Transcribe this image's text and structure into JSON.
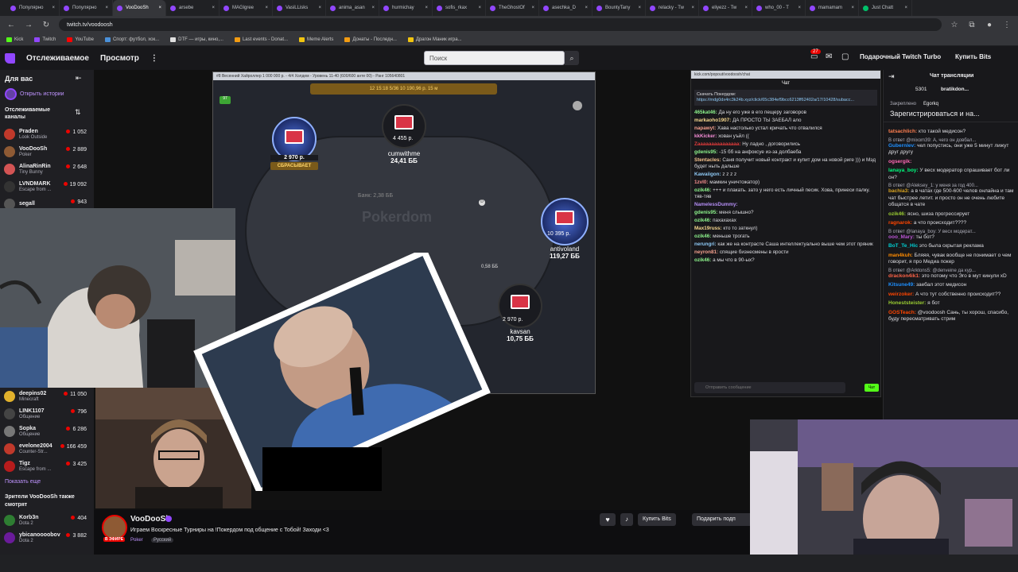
{
  "browser": {
    "tabs": [
      {
        "label": "Популярно",
        "color": "#9147ff"
      },
      {
        "label": "Популярно",
        "color": "#9147ff"
      },
      {
        "label": "VooDooSh",
        "color": "#9147ff",
        "active": true
      },
      {
        "label": "arsebe",
        "color": "#9147ff"
      },
      {
        "label": "MAGlgree",
        "color": "#9147ff"
      },
      {
        "label": "VasiLLisks",
        "color": "#9147ff"
      },
      {
        "label": "anima_asan",
        "color": "#9147ff"
      },
      {
        "label": "hurmichay",
        "color": "#9147ff"
      },
      {
        "label": "sofis_rkax",
        "color": "#9147ff"
      },
      {
        "label": "TheGhostOf",
        "color": "#9147ff"
      },
      {
        "label": "asechka_D",
        "color": "#9147ff"
      },
      {
        "label": "BountyTany",
        "color": "#9147ff"
      },
      {
        "label": "relacky - Tw",
        "color": "#9147ff"
      },
      {
        "label": "eliyezz - Tw",
        "color": "#9147ff"
      },
      {
        "label": "who_00 - T",
        "color": "#9147ff"
      },
      {
        "label": "mamamam",
        "color": "#9147ff"
      },
      {
        "label": "Just Chatt",
        "color": "#00c16a"
      }
    ],
    "url": "twitch.tv/voodoosh",
    "bookmarks": [
      {
        "label": "Kick",
        "color": "#53fc18"
      },
      {
        "label": "Twitch",
        "color": "#9147ff"
      },
      {
        "label": "YouTube",
        "color": "#ff0000"
      },
      {
        "label": "Спорт: футбол, хок...",
        "color": "#4a90d9"
      },
      {
        "label": "DTF — игры, кино,...",
        "color": "#e0e0e0"
      },
      {
        "label": "Last events - Donat...",
        "color": "#f39c12"
      },
      {
        "label": "Meme Alerts",
        "color": "#f1c40f"
      },
      {
        "label": "Донаты - Последн...",
        "color": "#f39c12"
      },
      {
        "label": "Драгон Маник игра...",
        "color": "#f1c40f"
      }
    ]
  },
  "topnav": {
    "following": "Отслеживаемое",
    "browse": "Просмотр",
    "more": "⋮",
    "search_placeholder": "Поиск",
    "notif_count": "27",
    "turbo": "Подарочный Twitch Turbo",
    "buy_bits": "Купить Bits"
  },
  "sidebar": {
    "title": "Для вас",
    "stories": "Открыть истории",
    "followed_title": "Отслеживаемые каналы",
    "channels": [
      {
        "name": "Praden",
        "game": "Look Outside",
        "viewers": "1 052",
        "color": "#c0392b"
      },
      {
        "name": "VooDooSh",
        "game": "Poker",
        "viewers": "2 889",
        "color": "#8e5a34"
      },
      {
        "name": "AlinaRinRin",
        "game": "Tiny Bunny",
        "viewers": "2 648",
        "color": "#d35454"
      },
      {
        "name": "LVNDMARK",
        "game": "Escape from ...",
        "viewers": "19 092",
        "color": "#333"
      },
      {
        "name": "segall",
        "game": "",
        "viewers": "943",
        "color": "#555"
      }
    ],
    "channels2": [
      {
        "name": "deepins02",
        "game": "Minecraft",
        "viewers": "11 050",
        "color": "#e1b12c"
      },
      {
        "name": "LINK1107",
        "game": "Общение",
        "viewers": "796",
        "color": "#444"
      },
      {
        "name": "Sopka",
        "game": "Общение",
        "viewers": "6 286",
        "color": "#777"
      },
      {
        "name": "evelone2004",
        "game": "Counter-Str...",
        "viewers": "166 459",
        "color": "#c0392b"
      },
      {
        "name": "Tigz",
        "game": "Escape from ...",
        "viewers": "3 425",
        "color": "#b71c1c"
      }
    ],
    "show_more": "Показать еще",
    "also_watch": "Зрители VooDooSh также смотрят",
    "channels3": [
      {
        "name": "Korb3n",
        "game": "Dota 2",
        "viewers": "404",
        "color": "#2e7d32"
      },
      {
        "name": "ybicanoooobov",
        "game": "Dota 2",
        "viewers": "3 882",
        "color": "#6a1b9a"
      }
    ]
  },
  "poker": {
    "title": "#8 Весенний Хайроллер 1 000 000 р. - 4/4 Холдем - Уровень 11-40 (600/600 анте 00) - Ранг 105640801",
    "top_bar": "12 15:18  5/36  10 190,96 р.  15 м",
    "pot": "Банк: 2,38 ББ",
    "brand": "Pokerdom",
    "seats": [
      {
        "nick": "",
        "stack": "2 970 р.",
        "action": "СБРАСЫВАЕТ"
      },
      {
        "nick": "cumwithme",
        "stack": "24,41 ББ",
        "bet": "4 455 р."
      },
      {
        "nick": "antivoland",
        "stack": "119,27 ББ",
        "bet": "10 395 р."
      },
      {
        "nick": "kavsan",
        "stack": "10,75 ББ",
        "bet": "2 970 р."
      }
    ],
    "center_bet": "0,58 ББ"
  },
  "chatwindow": {
    "url": "kick.com/popout/voodoosh/chat",
    "title": "Чат",
    "download": "Скачать Покердом:",
    "link": "https://mdg0dx4rc3k24b.xyz/click/65c384ef9bcc6213ff62402a/17/10428/subacc...",
    "messages": [
      {
        "user": "465kat46:",
        "text": "Да ну его уже в его пещеру заговоров",
        "color": "#8ef58d"
      },
      {
        "user": "markaoho1907:",
        "text": "ДА ПРОСТО ТЫ ЗАЕБАЛ ало",
        "color": "#f5d78e"
      },
      {
        "user": "napawyt:",
        "text": "Хава настолько устал кричать что отвалился",
        "color": "#f5a08e"
      },
      {
        "user": "kkKicker:",
        "text": "хован уъйл ((",
        "color": "#f58ed7"
      },
      {
        "user": "Zaaaaaaaaaaaaaaa:",
        "text": "Ну ладно , договорились",
        "color": "#e03b3b"
      },
      {
        "user": "gdenis95:",
        "text": "-15 бб на анфоксуе из-за долбаеба",
        "color": "#8ef58d"
      },
      {
        "user": "Stentacles:",
        "text": "Саня получит новый контракт и купит дом на новой риге ))) и Мэд будет ныть дальше",
        "color": "#f5c28e"
      },
      {
        "user": "Kawaiigon:",
        "text": "z z z z",
        "color": "#8ec9f5"
      },
      {
        "user": "1zvl0:",
        "text": "мамкин уничтожатор)",
        "color": "#f58e8e"
      },
      {
        "user": "ozik46:",
        "text": "+++ и плакать. зато у него есть личный песик. Хова, принеси палку. тяв-тяв",
        "color": "#8ef58d"
      },
      {
        "user": "NamelessDummy:",
        "text": "",
        "color": "#b48ef5"
      },
      {
        "user": "gdenis95:",
        "text": "меня слышно?",
        "color": "#8ef58d"
      },
      {
        "user": "ozik46:",
        "text": "пахахахах",
        "color": "#8ef58d"
      },
      {
        "user": "Max19russ:",
        "text": "кто то заткнул)",
        "color": "#f5d78e"
      },
      {
        "user": "ozik46:",
        "text": "меньше трогать",
        "color": "#8ef58d"
      },
      {
        "user": "nerungri:",
        "text": "как же на контрасте Саша интеллектуально выше чем этот пряник",
        "color": "#8ec9f5"
      },
      {
        "user": "neyron81:",
        "text": "спящие бизнесмены в ярости",
        "color": "#f5a08e"
      },
      {
        "user": "ozik46:",
        "text": "а мы что в 90-ых?",
        "color": "#8ef58d"
      }
    ],
    "input_placeholder": "Отправить сообщение",
    "send": "Чат"
  },
  "rightchat": {
    "title": "Чат трансляции",
    "pinned_user": "bratikdon...",
    "pinned_count": "5301",
    "pinned_label": "Закреплено",
    "pinned_by": "Egorkq",
    "register": "Зарегистрироваться и на...",
    "messages": [
      {
        "reply": "",
        "user": "tatsachlich:",
        "text": "кто такой медисон?",
        "color": "#ff7f50"
      },
      {
        "reply": "В ответ @mixom39: А, чего он довбал...",
        "user": "Gubernlev:",
        "text": "чел попустись, они уже 5 минут лижут друг другу",
        "color": "#1e90ff"
      },
      {
        "reply": "",
        "user": "ogsergik:",
        "text": "",
        "color": "#ff69b4"
      },
      {
        "reply": "",
        "user": "lanaya_boy:",
        "text": "У весх модератор спрашивает бот ли он?",
        "color": "#00ff7f"
      },
      {
        "reply": "В ответ @Aleksey_1: у меня за год 400...",
        "user": "bachia3:",
        "text": "а в чатах где 500-600 челов онлайна и там чат быстрее летит. и просто он не очень любите общатся в чате",
        "color": "#daa520"
      },
      {
        "reply": "",
        "user": "ozik46:",
        "text": "ясно, шиза прогрессирует",
        "color": "#9acd32"
      },
      {
        "reply": "",
        "user": "ragnarok:",
        "text": "а что происходит????",
        "color": "#ff4500"
      },
      {
        "reply": "В ответ @lanaya_boy: У весх модерат...",
        "user": "ooo_Mary:",
        "text": "ты бот?",
        "color": "#ba55d3"
      },
      {
        "reply": "",
        "user": "BoT_Te_Hic",
        "text": "это была скрытая реклама",
        "color": "#00ced1"
      },
      {
        "reply": "",
        "user": "man4kuh:",
        "text": "Бляяя, чувак вообще не понимает о чем говорит, я про Медиа покер",
        "color": "#ff8c00"
      },
      {
        "reply": "В ответ @Arktons5: @denveine да кур...",
        "user": "drackon4ik1:",
        "text": "это потому что Эго в мут кинули xD",
        "color": "#ff6347"
      },
      {
        "reply": "",
        "user": "Kitsune49:",
        "text": "заебал этот медисон",
        "color": "#1e90ff"
      },
      {
        "reply": "",
        "user": "weirzoker:",
        "text": "А что тут собственно происходит??",
        "color": "#ff4500"
      },
      {
        "reply": "",
        "user": "Honeststeister:",
        "text": "я бот",
        "color": "#9acd32"
      },
      {
        "reply": "",
        "user": "GOSTeach:",
        "text": "@voodoosh Сань, ты хорош, спасибо, буду пересматривать стрим",
        "color": "#ff4500"
      }
    ]
  },
  "infobar": {
    "channel": "VooDooSh",
    "live": "В ЭФИРЕ",
    "title": "Играем Воскресные Турниры на !Покердом под общение с Тобой! Заходи <3",
    "category": "Poker",
    "language": "Русский",
    "buy_bits": "Купить Bits",
    "gift": "Подарить подп"
  }
}
